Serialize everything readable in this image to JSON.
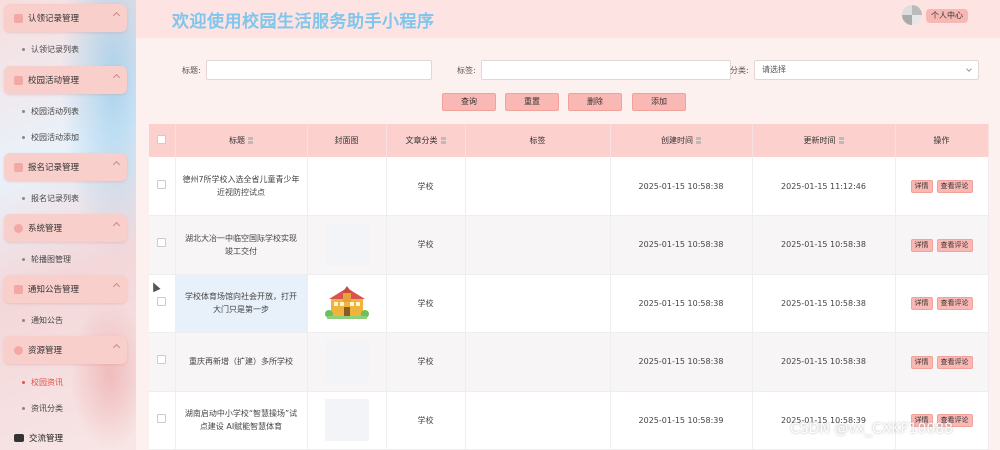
{
  "sidebar": {
    "groups": [
      {
        "label": "认领记录管理",
        "subs": [
          "认领记录列表"
        ]
      },
      {
        "label": "校园活动管理",
        "subs": [
          "校园活动列表",
          "校园活动添加"
        ]
      },
      {
        "label": "报名记录管理",
        "subs": [
          "报名记录列表"
        ]
      },
      {
        "label": "系统管理",
        "subs": [
          "轮播图管理"
        ]
      },
      {
        "label": "通知公告管理",
        "subs": [
          "通知公告"
        ]
      },
      {
        "label": "资源管理",
        "subs": [
          "校园资讯",
          "资讯分类"
        ]
      }
    ],
    "active_item": "校园资讯",
    "bottom_item": "交流管理"
  },
  "header": {
    "title": "欢迎使用校园生活服务助手小程序",
    "profile_label": "个人中心"
  },
  "filters": {
    "title_label": "标题:",
    "tag_label": "标签:",
    "category_label": "分类:",
    "category_placeholder": "请选择"
  },
  "actions": {
    "search": "查询",
    "reset": "重置",
    "delete": "删除",
    "add": "添加"
  },
  "table": {
    "headers": {
      "title": "标题",
      "cover": "封面图",
      "category": "文章分类",
      "tags": "标签",
      "created": "创建时间",
      "updated": "更新时间",
      "ops": "操作"
    },
    "rows": [
      {
        "title": "德州7所学校入选全省儿童青少年近视防控试点",
        "category": "学校",
        "tags": "",
        "created": "2025-01-15 10:58:38",
        "updated": "2025-01-15 11:12:46"
      },
      {
        "title": "湖北大冶一中临空国际学校实现竣工交付",
        "category": "学校",
        "tags": "",
        "created": "2025-01-15 10:58:38",
        "updated": "2025-01-15 10:58:38"
      },
      {
        "title": "学校体育场馆向社会开放，打开大门只是第一步",
        "category": "学校",
        "tags": "",
        "created": "2025-01-15 10:58:38",
        "updated": "2025-01-15 10:58:38"
      },
      {
        "title": "重庆再新增（扩建）多所学校",
        "category": "学校",
        "tags": "",
        "created": "2025-01-15 10:58:38",
        "updated": "2025-01-15 10:58:38"
      },
      {
        "title": "湖南启动中小学校“智慧操场”试点建设 AI赋能智慧体育",
        "category": "学校",
        "tags": "",
        "created": "2025-01-15 10:58:39",
        "updated": "2025-01-15 10:58:39"
      }
    ],
    "detail_label": "详情",
    "comment_label": "查看评论"
  },
  "watermark": "CSDN @vx_CXKF10088"
}
